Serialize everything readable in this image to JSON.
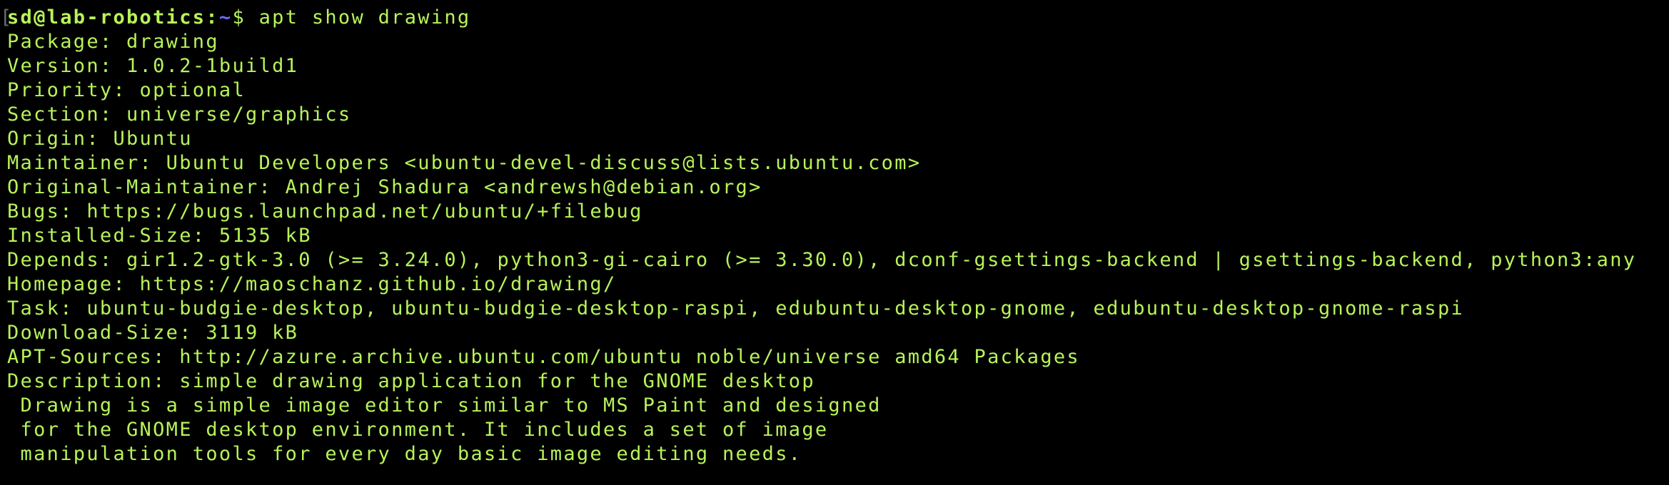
{
  "terminal": {
    "colors": {
      "background": "#000000",
      "text": "#b7f35a",
      "path": "#6d6dff"
    },
    "prompt": {
      "bracket": "[",
      "user_host": "sd@lab-robotics",
      "colon": ":",
      "path": "~",
      "symbol": "$ ",
      "command": "apt show drawing"
    },
    "output": [
      "Package: drawing",
      "Version: 1.0.2-1build1",
      "Priority: optional",
      "Section: universe/graphics",
      "Origin: Ubuntu",
      "Maintainer: Ubuntu Developers <ubuntu-devel-discuss@lists.ubuntu.com>",
      "Original-Maintainer: Andrej Shadura <andrewsh@debian.org>",
      "Bugs: https://bugs.launchpad.net/ubuntu/+filebug",
      "Installed-Size: 5135 kB",
      "Depends: gir1.2-gtk-3.0 (>= 3.24.0), python3-gi-cairo (>= 3.30.0), dconf-gsettings-backend | gsettings-backend, python3:any",
      "Homepage: https://maoschanz.github.io/drawing/",
      "Task: ubuntu-budgie-desktop, ubuntu-budgie-desktop-raspi, edubuntu-desktop-gnome, edubuntu-desktop-gnome-raspi",
      "Download-Size: 3119 kB",
      "APT-Sources: http://azure.archive.ubuntu.com/ubuntu noble/universe amd64 Packages",
      "Description: simple drawing application for the GNOME desktop",
      " Drawing is a simple image editor similar to MS Paint and designed",
      " for the GNOME desktop environment. It includes a set of image",
      " manipulation tools for every day basic image editing needs."
    ]
  }
}
